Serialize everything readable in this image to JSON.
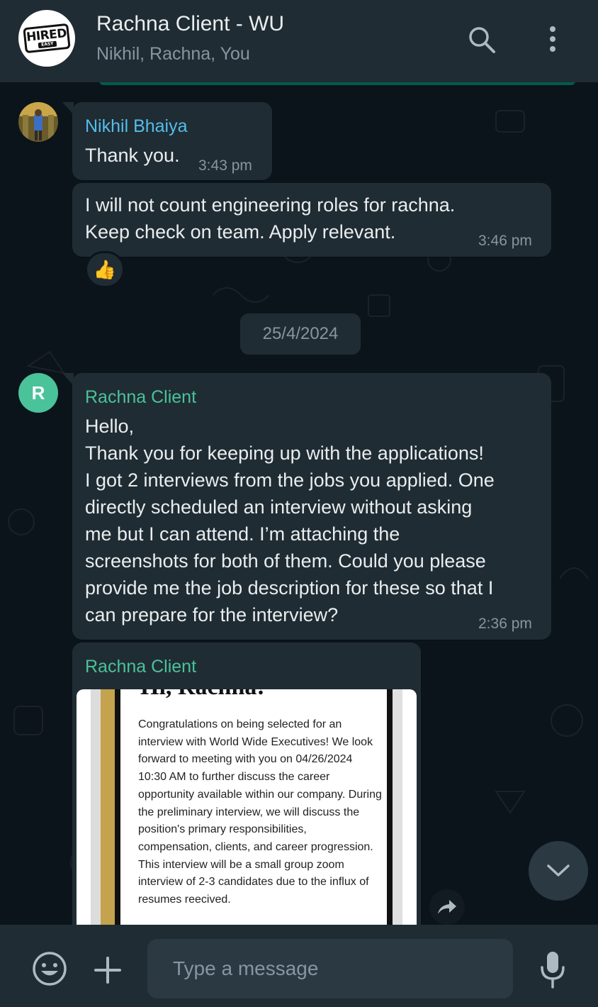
{
  "header": {
    "group_name": "Rachna Client - WU",
    "members": "Nikhil, Rachna, You",
    "logo_text": "HIRED",
    "logo_subtext": "EASY",
    "search_icon": "search-icon",
    "menu_icon": "more-vertical-icon"
  },
  "messages": [
    {
      "sender": "Nikhil Bhaiya",
      "sender_color": "#53bdeb",
      "text": "Thank you.",
      "time": "3:43 pm"
    },
    {
      "text": "I will not count engineering roles for rachna.\nKeep check on team. Apply relevant.",
      "time": "3:46 pm",
      "reaction": "👍"
    },
    {
      "date_chip": "25/4/2024"
    },
    {
      "sender": "Rachna Client",
      "sender_color": "#4ac29a",
      "avatar_letter": "R",
      "text": "Hello,\nThank you for keeping up with the applications!\nI got 2 interviews from the jobs you applied. One\ndirectly scheduled an interview without asking\nme but I can attend. I’m attaching the\nscreenshots for both of them. Could you please\nprovide me the job description for these so that I\ncan prepare for the interview?",
      "time": "2:36 pm"
    },
    {
      "sender": "Rachna Client",
      "sender_color": "#4ac29a",
      "image": {
        "heading": "Hi, Rachna!",
        "body": "Congratulations on being selected for an interview with World Wide Executives! We look forward to meeting with you on 04/26/2024 10:30 AM to further discuss the career opportunity available within our company.  During the preliminary interview, we will discuss the position's primary responsibilities, compensation, clients, and career progression. This interview will be a small group zoom interview of 2-3 candidates due to the influx of resumes reecived."
      }
    }
  ],
  "composer": {
    "placeholder": "Type a message",
    "emoji_icon": "emoji-icon",
    "attach_icon": "plus-icon",
    "mic_icon": "microphone-icon"
  },
  "colors": {
    "header_bg": "#202c33",
    "chat_bg": "#0b141a",
    "bubble_bg": "#202c33",
    "secondary_text": "#8696a0"
  }
}
